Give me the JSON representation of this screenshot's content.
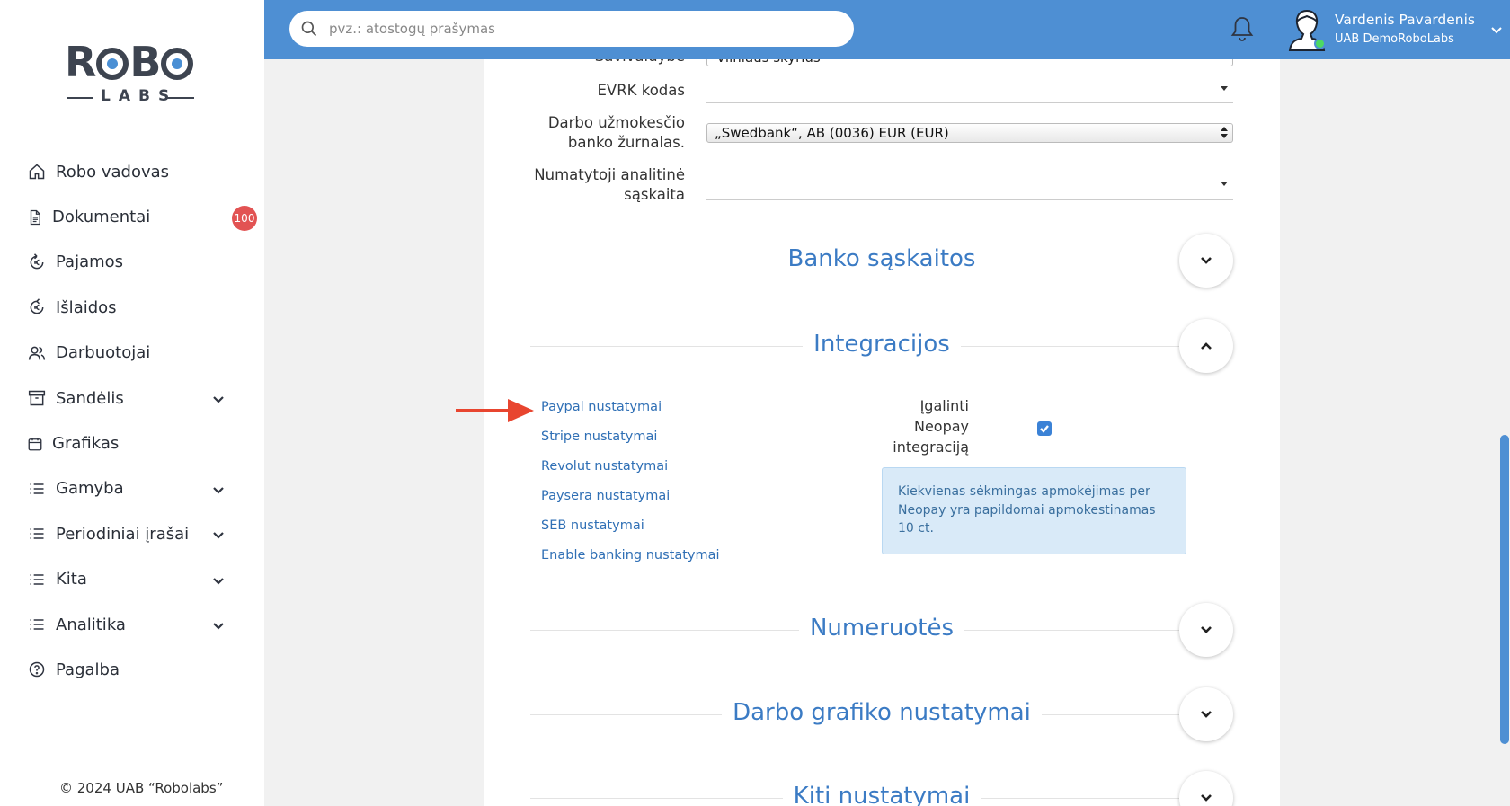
{
  "sidebar": {
    "logo": {
      "top": "ROBO",
      "bottom": "LABS"
    },
    "items": [
      {
        "label": "Robo vadovas",
        "icon": "home-icon"
      },
      {
        "label": "Dokumentai",
        "icon": "document-icon",
        "badge": "100"
      },
      {
        "label": "Pajamos",
        "icon": "income-icon"
      },
      {
        "label": "Išlaidos",
        "icon": "expense-icon"
      },
      {
        "label": "Darbuotojai",
        "icon": "users-icon"
      },
      {
        "label": "Sandėlis",
        "icon": "archive-icon",
        "expandable": true
      },
      {
        "label": "Grafikas",
        "icon": "calendar-icon"
      },
      {
        "label": "Gamyba",
        "icon": "list-icon",
        "expandable": true
      },
      {
        "label": "Periodiniai įrašai",
        "icon": "list-icon",
        "expandable": true
      },
      {
        "label": "Kita",
        "icon": "list-icon",
        "expandable": true
      },
      {
        "label": "Analitika",
        "icon": "list-icon",
        "expandable": true
      },
      {
        "label": "Pagalba",
        "icon": "help-icon"
      }
    ],
    "footer": "© 2024 UAB “Robolabs”"
  },
  "topbar": {
    "search_placeholder": "pvz.: atostogų prašymas",
    "user_name": "Vardenis Pavardenis",
    "user_company": "UAB DemoRoboLabs"
  },
  "form": {
    "partial_label": "Savivaldybė",
    "partial_value": "Vilniaus skyrius",
    "evrk_label": "EVRK kodas",
    "bank_journal_label_1": "Darbo užmokesčio",
    "bank_journal_label_2": "banko žurnalas.",
    "bank_journal_value": "„Swedbank“, AB (0036) EUR (EUR)",
    "analytic_label_1": "Numatytoji analitinė",
    "analytic_label_2": "sąskaita"
  },
  "sections": {
    "bank_accounts": "Banko sąskaitos",
    "integrations": "Integracijos",
    "numbering": "Numeruotės",
    "work_schedule": "Darbo grafiko nustatymai",
    "other": "Kiti nustatymai"
  },
  "integrations": {
    "links": [
      "Paypal nustatymai",
      "Stripe nustatymai",
      "Revolut nustatymai",
      "Paysera nustatymai",
      "SEB nustatymai",
      "Enable banking nustatymai"
    ],
    "neopay_label_1": "Įgalinti",
    "neopay_label_2": "Neopay",
    "neopay_label_3": "integraciją",
    "neopay_enabled": true,
    "info_text": "Kiekvienas sėkmingas apmokėjimas per Neopay yra papildomai apmokestinamas 10 ct."
  },
  "colors": {
    "brand": "#4e8fd3",
    "section_title": "#3b7bc4",
    "link": "#2f6fb5",
    "badge": "#e25353",
    "arrow": "#e8452f"
  }
}
